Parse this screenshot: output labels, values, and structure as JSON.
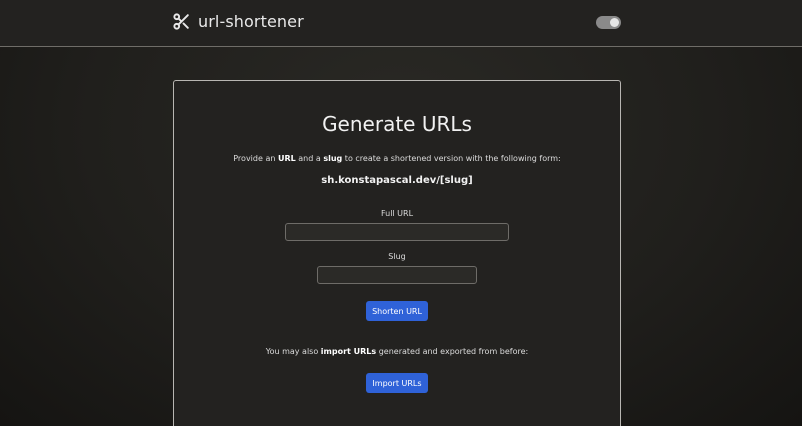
{
  "header": {
    "brand_name": "url-shortener",
    "brand_icon": "scissors-icon",
    "theme_toggle": {
      "state": "on",
      "icon": "toggle-switch"
    }
  },
  "card": {
    "title": "Generate URLs",
    "description": {
      "part1": "Provide an ",
      "bold1": "URL",
      "part2": " and a ",
      "bold2": "slug",
      "part3": " to create a shortened version with the following form:"
    },
    "domain_format": "sh.konstapascal.dev/[slug]",
    "full_url_label": "Full URL",
    "full_url_value": "",
    "slug_label": "Slug",
    "slug_value": "",
    "shorten_button": "Shorten URL",
    "import_text": {
      "part1": "You may also ",
      "bold": "import URLs",
      "part2": " generated and exported from before:"
    },
    "import_button": "Import URLs"
  },
  "colors": {
    "accent": "#2f62d8",
    "background": "#1c1b18",
    "card": "#232220"
  }
}
